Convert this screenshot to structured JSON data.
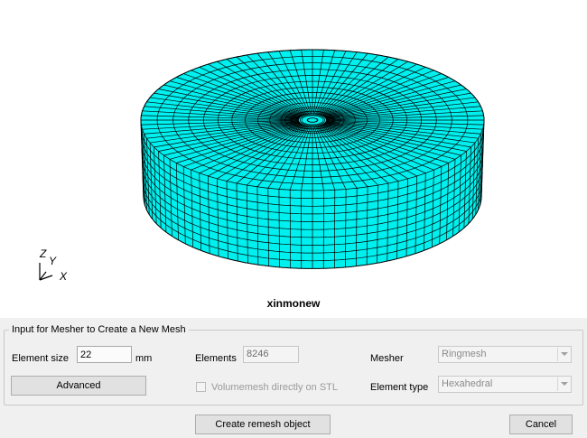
{
  "viewport": {
    "model_name": "xinmonew",
    "axes": {
      "z": "Z",
      "y": "Y",
      "x": "X"
    },
    "mesh_color": "#00f0f0",
    "mesh_line_color": "#000000"
  },
  "panel": {
    "group_title": "Input for Mesher to Create a New Mesh",
    "element_size": {
      "label": "Element size",
      "value": "22",
      "unit": "mm"
    },
    "elements": {
      "label": "Elements",
      "value": "8246"
    },
    "mesher": {
      "label": "Mesher",
      "value": "Ringmesh"
    },
    "element_type": {
      "label": "Element type",
      "value": "Hexahedral"
    },
    "advanced_label": "Advanced",
    "volumemesh": {
      "label": "Volumemesh directly on STL",
      "checked": false
    },
    "create_label": "Create remesh object",
    "cancel_label": "Cancel"
  }
}
